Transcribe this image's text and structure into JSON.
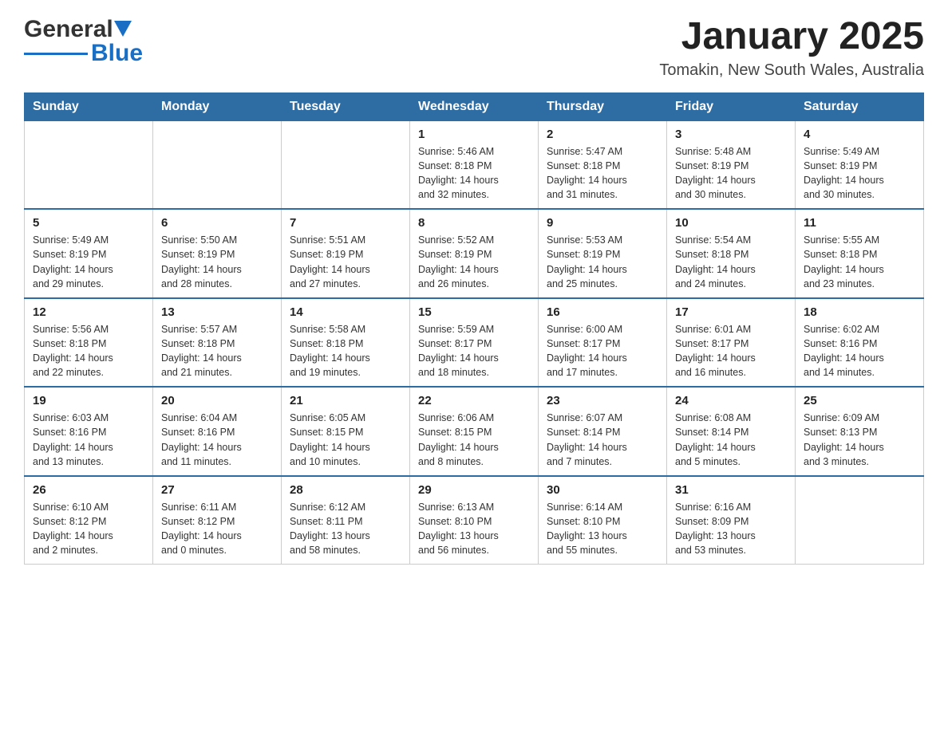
{
  "header": {
    "logo_black": "General",
    "logo_blue": "Blue",
    "title": "January 2025",
    "subtitle": "Tomakin, New South Wales, Australia"
  },
  "days_of_week": [
    "Sunday",
    "Monday",
    "Tuesday",
    "Wednesday",
    "Thursday",
    "Friday",
    "Saturday"
  ],
  "weeks": [
    {
      "days": [
        {
          "num": "",
          "info": ""
        },
        {
          "num": "",
          "info": ""
        },
        {
          "num": "",
          "info": ""
        },
        {
          "num": "1",
          "info": "Sunrise: 5:46 AM\nSunset: 8:18 PM\nDaylight: 14 hours\nand 32 minutes."
        },
        {
          "num": "2",
          "info": "Sunrise: 5:47 AM\nSunset: 8:18 PM\nDaylight: 14 hours\nand 31 minutes."
        },
        {
          "num": "3",
          "info": "Sunrise: 5:48 AM\nSunset: 8:19 PM\nDaylight: 14 hours\nand 30 minutes."
        },
        {
          "num": "4",
          "info": "Sunrise: 5:49 AM\nSunset: 8:19 PM\nDaylight: 14 hours\nand 30 minutes."
        }
      ]
    },
    {
      "days": [
        {
          "num": "5",
          "info": "Sunrise: 5:49 AM\nSunset: 8:19 PM\nDaylight: 14 hours\nand 29 minutes."
        },
        {
          "num": "6",
          "info": "Sunrise: 5:50 AM\nSunset: 8:19 PM\nDaylight: 14 hours\nand 28 minutes."
        },
        {
          "num": "7",
          "info": "Sunrise: 5:51 AM\nSunset: 8:19 PM\nDaylight: 14 hours\nand 27 minutes."
        },
        {
          "num": "8",
          "info": "Sunrise: 5:52 AM\nSunset: 8:19 PM\nDaylight: 14 hours\nand 26 minutes."
        },
        {
          "num": "9",
          "info": "Sunrise: 5:53 AM\nSunset: 8:19 PM\nDaylight: 14 hours\nand 25 minutes."
        },
        {
          "num": "10",
          "info": "Sunrise: 5:54 AM\nSunset: 8:18 PM\nDaylight: 14 hours\nand 24 minutes."
        },
        {
          "num": "11",
          "info": "Sunrise: 5:55 AM\nSunset: 8:18 PM\nDaylight: 14 hours\nand 23 minutes."
        }
      ]
    },
    {
      "days": [
        {
          "num": "12",
          "info": "Sunrise: 5:56 AM\nSunset: 8:18 PM\nDaylight: 14 hours\nand 22 minutes."
        },
        {
          "num": "13",
          "info": "Sunrise: 5:57 AM\nSunset: 8:18 PM\nDaylight: 14 hours\nand 21 minutes."
        },
        {
          "num": "14",
          "info": "Sunrise: 5:58 AM\nSunset: 8:18 PM\nDaylight: 14 hours\nand 19 minutes."
        },
        {
          "num": "15",
          "info": "Sunrise: 5:59 AM\nSunset: 8:17 PM\nDaylight: 14 hours\nand 18 minutes."
        },
        {
          "num": "16",
          "info": "Sunrise: 6:00 AM\nSunset: 8:17 PM\nDaylight: 14 hours\nand 17 minutes."
        },
        {
          "num": "17",
          "info": "Sunrise: 6:01 AM\nSunset: 8:17 PM\nDaylight: 14 hours\nand 16 minutes."
        },
        {
          "num": "18",
          "info": "Sunrise: 6:02 AM\nSunset: 8:16 PM\nDaylight: 14 hours\nand 14 minutes."
        }
      ]
    },
    {
      "days": [
        {
          "num": "19",
          "info": "Sunrise: 6:03 AM\nSunset: 8:16 PM\nDaylight: 14 hours\nand 13 minutes."
        },
        {
          "num": "20",
          "info": "Sunrise: 6:04 AM\nSunset: 8:16 PM\nDaylight: 14 hours\nand 11 minutes."
        },
        {
          "num": "21",
          "info": "Sunrise: 6:05 AM\nSunset: 8:15 PM\nDaylight: 14 hours\nand 10 minutes."
        },
        {
          "num": "22",
          "info": "Sunrise: 6:06 AM\nSunset: 8:15 PM\nDaylight: 14 hours\nand 8 minutes."
        },
        {
          "num": "23",
          "info": "Sunrise: 6:07 AM\nSunset: 8:14 PM\nDaylight: 14 hours\nand 7 minutes."
        },
        {
          "num": "24",
          "info": "Sunrise: 6:08 AM\nSunset: 8:14 PM\nDaylight: 14 hours\nand 5 minutes."
        },
        {
          "num": "25",
          "info": "Sunrise: 6:09 AM\nSunset: 8:13 PM\nDaylight: 14 hours\nand 3 minutes."
        }
      ]
    },
    {
      "days": [
        {
          "num": "26",
          "info": "Sunrise: 6:10 AM\nSunset: 8:12 PM\nDaylight: 14 hours\nand 2 minutes."
        },
        {
          "num": "27",
          "info": "Sunrise: 6:11 AM\nSunset: 8:12 PM\nDaylight: 14 hours\nand 0 minutes."
        },
        {
          "num": "28",
          "info": "Sunrise: 6:12 AM\nSunset: 8:11 PM\nDaylight: 13 hours\nand 58 minutes."
        },
        {
          "num": "29",
          "info": "Sunrise: 6:13 AM\nSunset: 8:10 PM\nDaylight: 13 hours\nand 56 minutes."
        },
        {
          "num": "30",
          "info": "Sunrise: 6:14 AM\nSunset: 8:10 PM\nDaylight: 13 hours\nand 55 minutes."
        },
        {
          "num": "31",
          "info": "Sunrise: 6:16 AM\nSunset: 8:09 PM\nDaylight: 13 hours\nand 53 minutes."
        },
        {
          "num": "",
          "info": ""
        }
      ]
    }
  ]
}
